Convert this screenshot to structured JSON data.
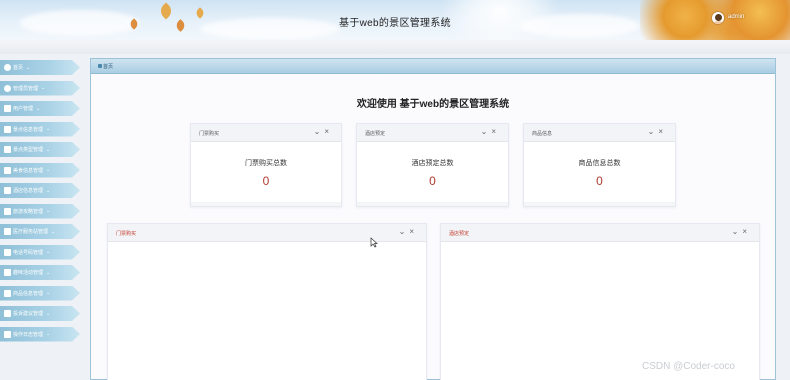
{
  "header": {
    "title": "基于web的景区管理系统",
    "user_name": "admin",
    "avatar_icon": "user-avatar-icon"
  },
  "sidebar": {
    "items": [
      {
        "label": "首页",
        "icon": "home-icon"
      },
      {
        "label": "管理员管理",
        "icon": "gear-icon"
      },
      {
        "label": "用户管理",
        "icon": "user-icon"
      },
      {
        "label": "景点信息管理",
        "icon": "list-icon"
      },
      {
        "label": "景点类型管理",
        "icon": "list-icon"
      },
      {
        "label": "美食信息管理",
        "icon": "list-icon"
      },
      {
        "label": "酒店信息管理",
        "icon": "list-icon"
      },
      {
        "label": "旅游攻略管理",
        "icon": "list-icon"
      },
      {
        "label": "医疗服务站管理",
        "icon": "list-icon"
      },
      {
        "label": "电话号码管理",
        "icon": "list-icon"
      },
      {
        "label": "趣味活动管理",
        "icon": "list-icon"
      },
      {
        "label": "商品信息管理",
        "icon": "list-icon"
      },
      {
        "label": "投诉建议管理",
        "icon": "list-icon"
      },
      {
        "label": "操作日志管理",
        "icon": "list-icon"
      }
    ]
  },
  "breadcrumb": {
    "label": "首页"
  },
  "welcome": "欢迎使用 基于web的景区管理系统",
  "stats": [
    {
      "title": "门票购买",
      "label": "门票购买总数",
      "value": "0"
    },
    {
      "title": "酒店预定",
      "label": "酒店预定总数",
      "value": "0"
    },
    {
      "title": "商品信息",
      "label": "商品信息总数",
      "value": "0"
    }
  ],
  "panels": [
    {
      "title": "门票购买"
    },
    {
      "title": "酒店预定"
    }
  ],
  "watermark": "CSDN @Coder-coco",
  "colors": {
    "accent": "#a9d2e6",
    "stat_value": "#b03a2e",
    "panel_title": "#c0392b"
  }
}
